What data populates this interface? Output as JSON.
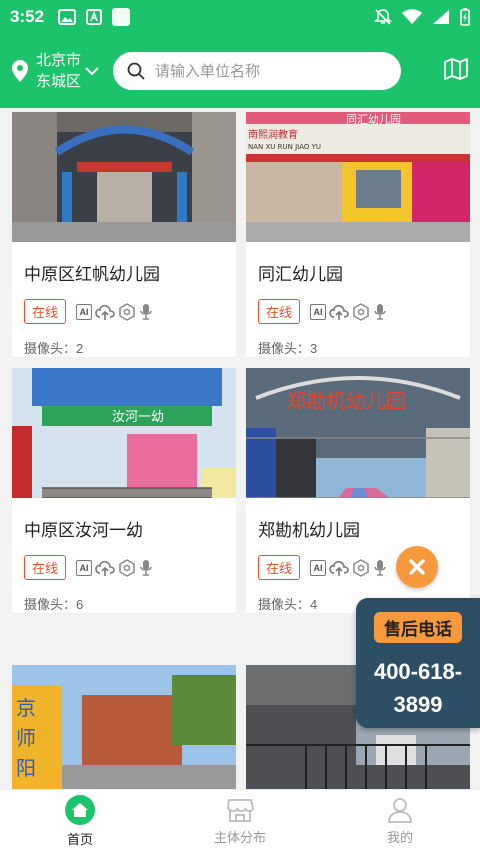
{
  "status_bar": {
    "time": "3:52"
  },
  "header": {
    "location_line1": "北京市",
    "location_line2": "东城区",
    "search_placeholder": "请输入单位名称"
  },
  "colors": {
    "brand": "#1dc36a",
    "online": "#e8502d",
    "accent": "#f79a3d",
    "panel": "#2c4f66"
  },
  "cards": [
    {
      "title": "中原区红帆幼儿园",
      "online": "在线",
      "camera": "摄像头：2"
    },
    {
      "title": "同汇幼儿园",
      "online": "在线",
      "camera": "摄像头：3"
    },
    {
      "title": "中原区汝河一幼",
      "online": "在线",
      "camera": "摄像头：6"
    },
    {
      "title": "郑勘机幼儿园",
      "online": "在线",
      "camera": "摄像头：4"
    }
  ],
  "photo_text": {
    "card1_sign": "南熙润教育",
    "card1_sub": "NAN XU RUN JIAO YU",
    "card1_top": "同汇幼儿园",
    "card2_sign": "汝河一幼",
    "card3_sign": "郑勘机幼儿园",
    "card4_sign": "京师阳"
  },
  "feature_icons": [
    "ai-icon",
    "cloud-upload-icon",
    "shield-camera-icon",
    "microphone-icon"
  ],
  "after_sales": {
    "label": "售后电话",
    "phone_line1": "400-618-",
    "phone_line2": "3899"
  },
  "nav": [
    {
      "label": "首页",
      "icon": "home-icon"
    },
    {
      "label": "主体分布",
      "icon": "store-icon"
    },
    {
      "label": "我的",
      "icon": "user-icon"
    }
  ]
}
